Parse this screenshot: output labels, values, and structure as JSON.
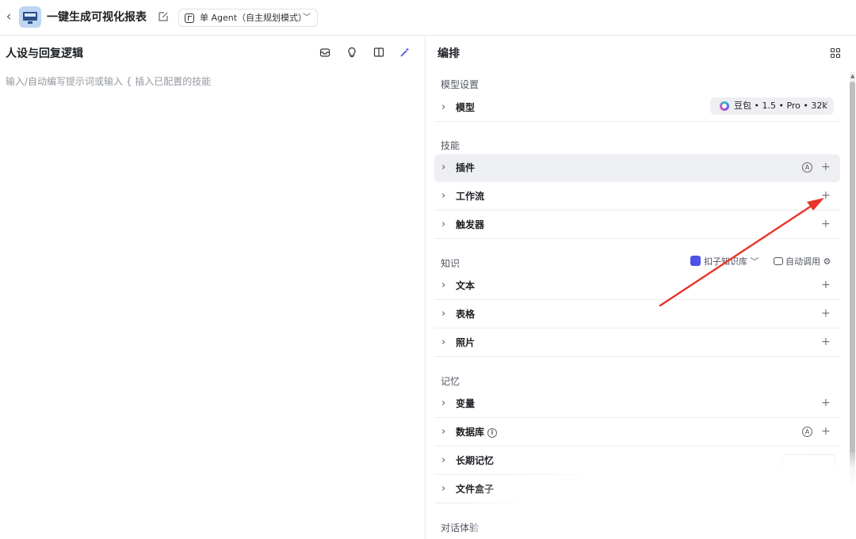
{
  "header": {
    "back_icon": "chevron-left-icon",
    "app_title": "一键生成可视化报表",
    "mode_label": "单 Agent（自主规划模式）"
  },
  "left_panel": {
    "title": "人设与回复逻辑",
    "placeholder": "输入/自动编写提示词或输入 { 插入已配置的技能",
    "tools": [
      "archive-icon",
      "lightbulb-icon",
      "split-view-icon",
      "magic-wand-icon"
    ]
  },
  "right_panel": {
    "title": "编排",
    "sections": {
      "model": {
        "label": "模型设置",
        "row_label": "模型",
        "model_name": "豆包 • 1.5 • Pro • 32k"
      },
      "skills": {
        "label": "技能",
        "items": [
          "插件",
          "工作流",
          "触发器"
        ]
      },
      "knowledge": {
        "label": "知识",
        "source": "扣子知识库",
        "auto_call": "自动调用",
        "items": [
          "文本",
          "表格",
          "照片"
        ]
      },
      "memory": {
        "label": "记忆",
        "items": [
          "变量",
          "数据库",
          "长期记忆",
          "文件盒子"
        ]
      },
      "dialog": {
        "label": "对话体验"
      }
    },
    "auto_badge": "A",
    "plus": "+"
  },
  "annotation": {
    "arrow_color": "#e8342a"
  }
}
